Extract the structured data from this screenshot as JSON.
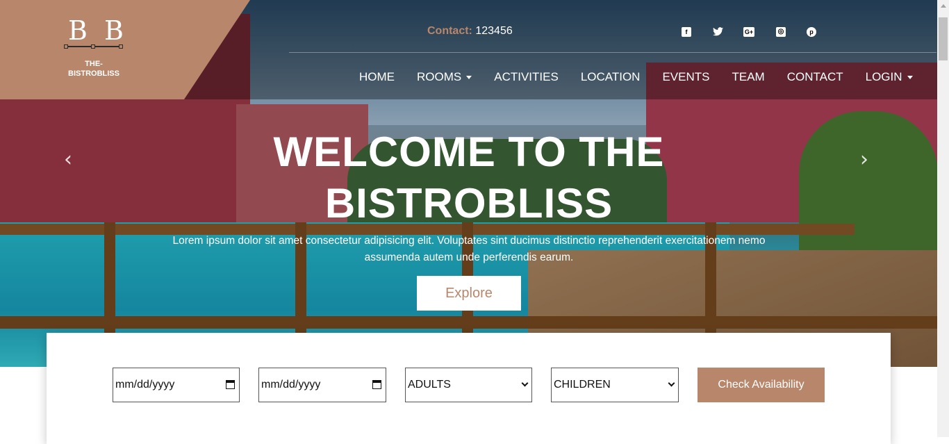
{
  "logo": {
    "mark": "B B",
    "name_line1": "THE-",
    "name_line2": "BISTROBLISS"
  },
  "contact": {
    "label": "Contact:",
    "value": "123456"
  },
  "social": [
    {
      "icon": "facebook-icon",
      "glyph": "f"
    },
    {
      "icon": "twitter-icon",
      "glyph": "t"
    },
    {
      "icon": "google-plus-icon",
      "glyph": "G+"
    },
    {
      "icon": "instagram-icon",
      "glyph": "◎"
    },
    {
      "icon": "pinterest-icon",
      "glyph": "p"
    }
  ],
  "nav": {
    "home": "HOME",
    "rooms": "ROOMS",
    "activities": "ACTIVITIES",
    "location": "LOCATION",
    "events": "EVENTS",
    "team": "TEAM",
    "contact": "CONTACT",
    "login": "LOGIN"
  },
  "carousel": {
    "prev": "‹",
    "next": "›"
  },
  "hero": {
    "title_line1": "WELCOME TO THE",
    "title_line2": "BISTROBLISS",
    "subtitle": "Lorem ipsum dolor sit amet consectetur adipisicing elit. Voluptates sint ducimus distinctio reprehenderit exercitationem nemo assumenda autem unde perferendis earum.",
    "cta": "Explore"
  },
  "booking": {
    "checkin_value": "mm/dd/yyyy",
    "checkout_value": "mm/dd/yyyy",
    "adults": "ADULTS",
    "children": "CHILDREN",
    "button": "Check Availability"
  },
  "colors": {
    "accent": "#b8876b"
  }
}
